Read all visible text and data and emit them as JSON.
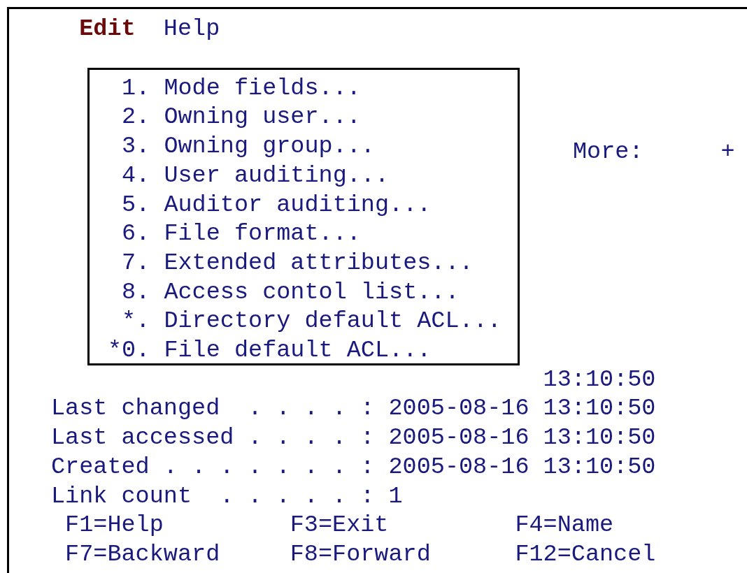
{
  "menu_bar": [
    {
      "label": "Edit",
      "selected": true
    },
    {
      "label": "Help",
      "selected": false
    }
  ],
  "popup_menu": {
    "items": [
      {
        "number": "1.",
        "label": "Mode fields..."
      },
      {
        "number": "2.",
        "label": "Owning user..."
      },
      {
        "number": "3.",
        "label": "Owning group..."
      },
      {
        "number": "4.",
        "label": "User auditing..."
      },
      {
        "number": "5.",
        "label": "Auditor auditing..."
      },
      {
        "number": "6.",
        "label": "File format..."
      },
      {
        "number": "7.",
        "label": "Extended attributes..."
      },
      {
        "number": "8.",
        "label": "Access contol list..."
      },
      {
        "number": "*.",
        "label": "Directory default ACL..."
      },
      {
        "number": "*0.",
        "label": "File default ACL..."
      }
    ]
  },
  "more_indicator": {
    "label": "More:",
    "symbol": "+"
  },
  "partial_value": "13:10:50",
  "fields": [
    {
      "label": "Last changed  . . . . :",
      "value": "2005-08-16 13:10:50"
    },
    {
      "label": "Last accessed . . . . :",
      "value": "2005-08-16 13:10:50"
    },
    {
      "label": "Created . . . . . . . :",
      "value": "2005-08-16 13:10:50"
    },
    {
      "label": "Link count  . . . . . :",
      "value": "1"
    }
  ],
  "function_keys": [
    [
      "F1=Help",
      "F3=Exit",
      "F4=Name"
    ],
    [
      "F7=Backward",
      "F8=Forward",
      "F12=Cancel"
    ]
  ]
}
